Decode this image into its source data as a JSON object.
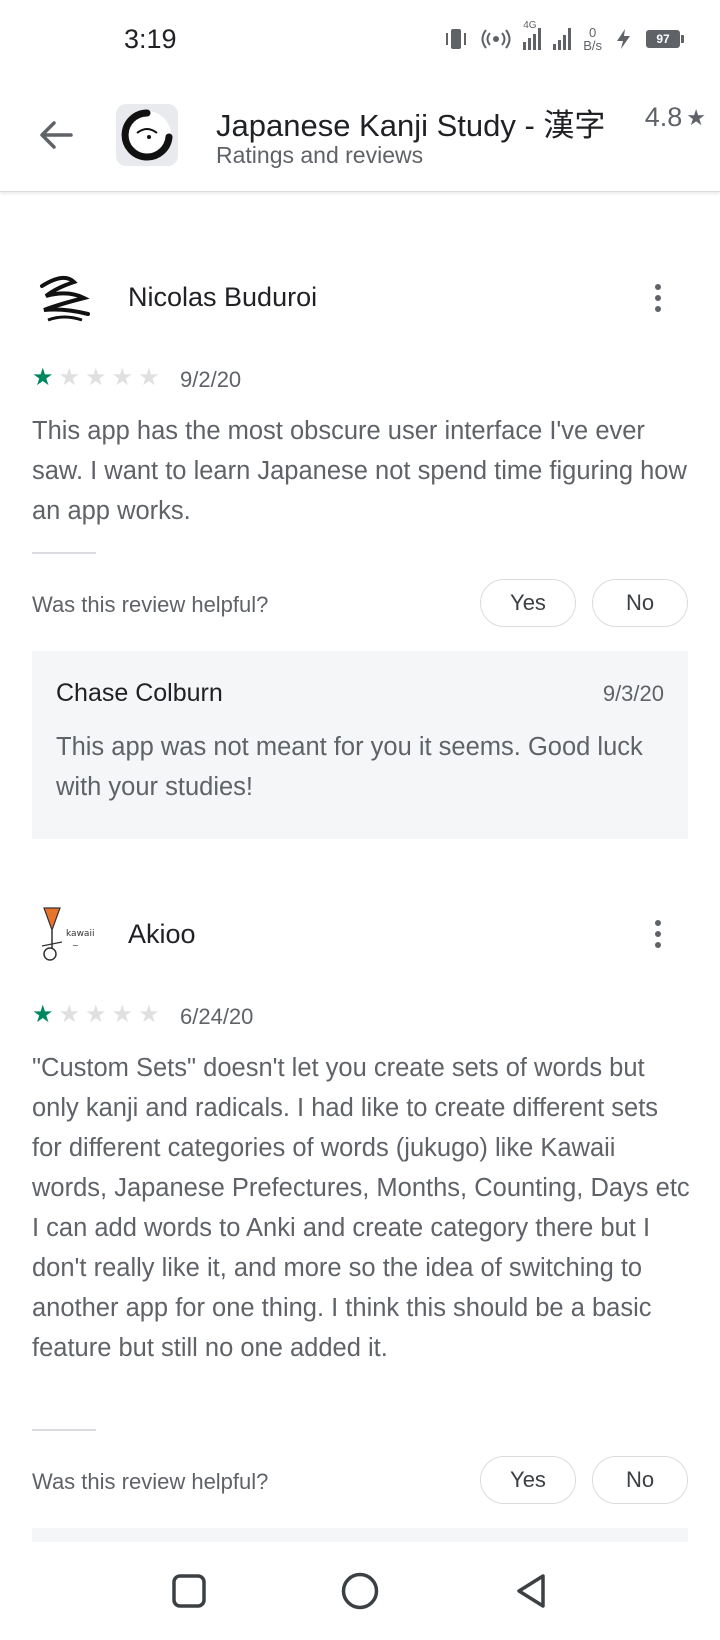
{
  "status": {
    "time": "3:19",
    "network": "4G",
    "net_speed_value": "0",
    "net_speed_unit": "B/s",
    "battery": "97"
  },
  "header": {
    "title": "Japanese Kanji Study - 漢字",
    "subtitle": "Ratings and reviews",
    "rating": "4.8",
    "rating_star": "★"
  },
  "reviews": [
    {
      "author": "Nicolas Buduroi",
      "stars": 1,
      "date": "9/2/20",
      "text": "This app has the most obscure user interface I've ever saw. I want to learn Japanese not spend time figuring how an app works.",
      "helpful_prompt": "Was this review helpful?",
      "yes_label": "Yes",
      "no_label": "No",
      "reply": {
        "author": "Chase Colburn",
        "date": "9/3/20",
        "text": "This app was not meant for you it seems. Good luck with your studies!"
      }
    },
    {
      "author": "Akioo",
      "stars": 1,
      "date": "6/24/20",
      "text": "\"Custom Sets\" doesn't let you create sets of words but only kanji and radicals. I had like to create different sets for different categories of words (jukugo) like Kawaii words, Japanese Prefectures, Months, Counting, Days etc I can add words to Anki and create category there but I don't really like it, and more so the idea of switching to another app for one thing. I think this should be a basic feature but still no one added it.",
      "helpful_prompt": "Was this review helpful?",
      "yes_label": "Yes",
      "no_label": "No"
    }
  ],
  "colors": {
    "star_on": "#01875f",
    "star_off": "#e0e0e0",
    "text_secondary": "#5f6368",
    "reply_bg": "#f5f6f8"
  },
  "icons": {
    "back": "arrow-left",
    "more": "vertical-dots",
    "nav_recents": "square",
    "nav_home": "circle",
    "nav_back": "triangle-left"
  }
}
